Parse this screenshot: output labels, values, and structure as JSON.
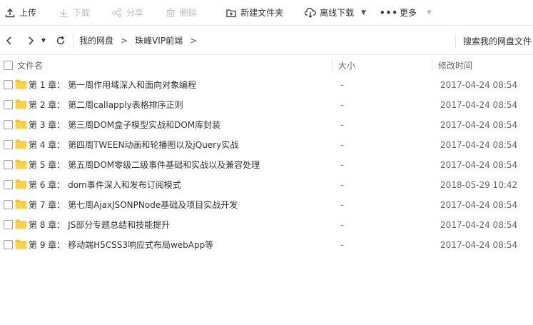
{
  "toolbar": {
    "upload": "上传",
    "download": "下载",
    "share": "分享",
    "delete": "删除",
    "new_folder": "新建文件夹",
    "offline_download": "离线下载",
    "more": "更多"
  },
  "nav": {
    "crumbs": [
      "我的网盘",
      "珠峰VIP前端"
    ],
    "search": "搜索我的网盘文件"
  },
  "columns": {
    "name": "文件名",
    "size": "大小",
    "modified": "修改时间"
  },
  "files": [
    {
      "name": "第 1 章： 第一周作用域深入和面向对象编程",
      "size": "-",
      "modified": "2017-04-24 08:54"
    },
    {
      "name": "第 2 章： 第二周callapply表格排序正则",
      "size": "-",
      "modified": "2017-04-24 08:54"
    },
    {
      "name": "第 3 章： 第三周DOM盒子模型实战和DOM库封装",
      "size": "-",
      "modified": "2017-04-24 08:54"
    },
    {
      "name": "第 4 章： 第四周TWEEN动画和轮播图以及jQuery实战",
      "size": "-",
      "modified": "2017-04-24 08:54"
    },
    {
      "name": "第 5 章： 第五周DOM零级二级事件基础和实战以及兼容处理",
      "size": "-",
      "modified": "2017-04-24 08:54"
    },
    {
      "name": "第 6 章： dom事件深入和发布订阅模式",
      "size": "-",
      "modified": "2018-05-29 10:42"
    },
    {
      "name": "第 7 章： 第七周AjaxJSONPNode基础及项目实战开发",
      "size": "-",
      "modified": "2017-04-24 08:54"
    },
    {
      "name": "第 8 章： JS部分专题总结和技能提升",
      "size": "-",
      "modified": "2017-04-24 08:54"
    },
    {
      "name": "第 9 章： 移动端H5CSS3响应式布局webApp等",
      "size": "-",
      "modified": "2017-04-24 08:54"
    }
  ]
}
